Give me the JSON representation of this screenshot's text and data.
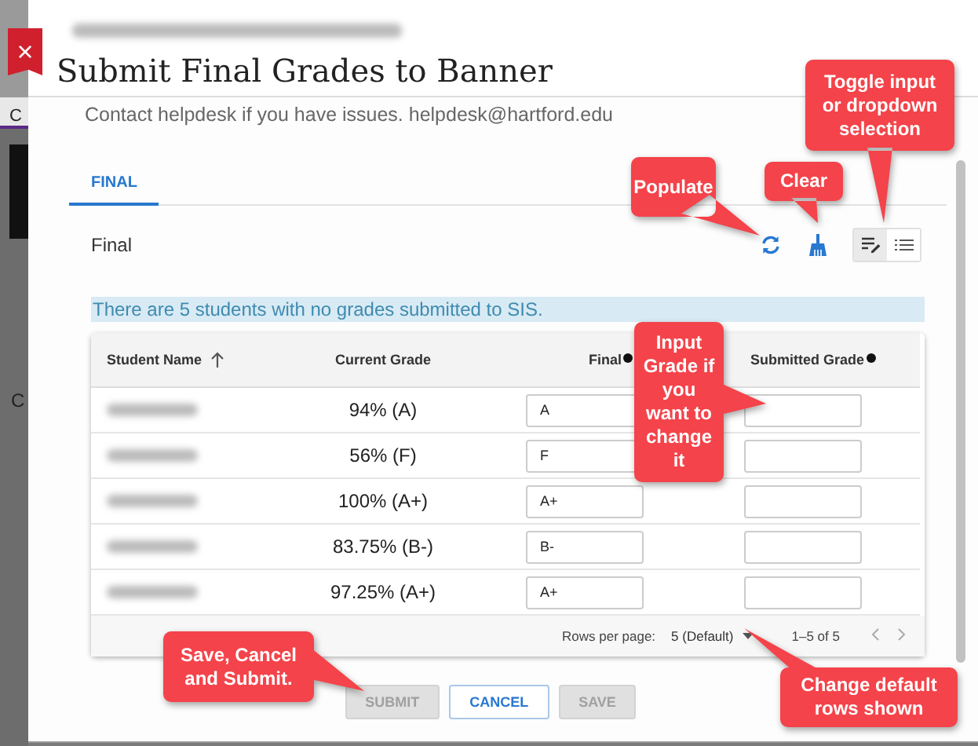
{
  "background": {
    "tab_fragment": "C",
    "text_fragment": "C"
  },
  "window": {
    "title": "Submit Final Grades to Banner",
    "close_icon": "×"
  },
  "contact": "Contact helpdesk if you have issues. helpdesk@hartford.edu",
  "tabs": [
    {
      "label": "FINAL",
      "selected": true
    }
  ],
  "section": {
    "label": "Final"
  },
  "view_modes": [
    {
      "kind": "input",
      "selected": true
    },
    {
      "kind": "list",
      "selected": false
    }
  ],
  "notice": "There are 5 students with no grades submitted to SIS.",
  "table": {
    "columns": [
      {
        "label": "Student Name",
        "kind": "sort"
      },
      {
        "label": "Current Grade",
        "kind": "plain"
      },
      {
        "label": "Final",
        "kind": "info"
      },
      {
        "label": "Submitted Grade",
        "kind": "info"
      }
    ],
    "rows": [
      {
        "current_grade": "94% (A)",
        "final": "A"
      },
      {
        "current_grade": "56% (F)",
        "final": "F"
      },
      {
        "current_grade": "100% (A+)",
        "final": "A+"
      },
      {
        "current_grade": "83.75% (B-)",
        "final": "B-"
      },
      {
        "current_grade": "97.25% (A+)",
        "final": "A+"
      }
    ]
  },
  "pagination": {
    "rows_per_page_label": "Rows per page:",
    "rows_per_page": "5 (Default)",
    "range": "1–5 of 5"
  },
  "buttons": [
    {
      "label": "SUBMIT",
      "disabled": true
    },
    {
      "label": "CANCEL",
      "disabled": false
    },
    {
      "label": "SAVE",
      "disabled": true
    }
  ],
  "callouts": [
    {
      "text": "Toggle input or dropdown selection"
    },
    {
      "text": "Populate"
    },
    {
      "text": "Clear"
    },
    {
      "text": "Input Grade if you want to change it"
    },
    {
      "text": "Save, Cancel and Submit."
    },
    {
      "text": "Change default rows shown"
    }
  ]
}
